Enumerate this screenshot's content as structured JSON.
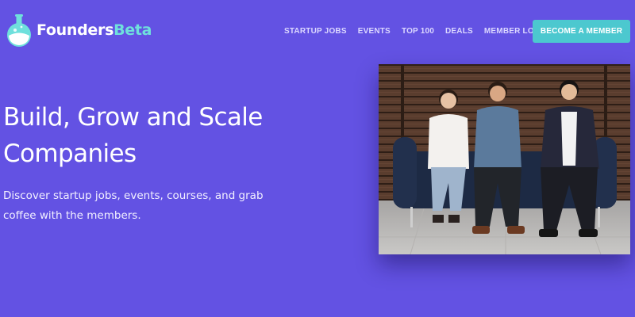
{
  "header": {
    "logo": {
      "part1": "Founders",
      "part2": "Beta"
    },
    "nav": [
      "STARTUP JOBS",
      "EVENTS",
      "TOP 100",
      "DEALS",
      "MEMBER LOGIN"
    ],
    "cta_label": "BECOME A MEMBER"
  },
  "hero": {
    "headline": "Build, Grow and Scale Companies",
    "subtitle": "Discover startup jobs, events, courses, and grab coffee with the members."
  },
  "colors": {
    "background": "#6352e3",
    "accent": "#4cc8cf",
    "logo_accent": "#6fe0dc"
  },
  "icons": {
    "logo": "flask-icon"
  }
}
